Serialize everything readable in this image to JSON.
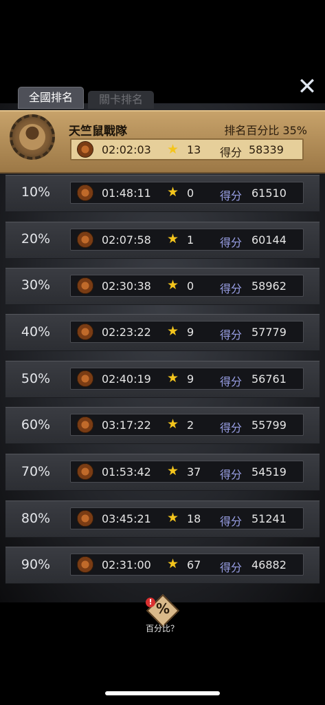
{
  "tabs": [
    {
      "label": "全國排名",
      "active": true
    },
    {
      "label": "關卡排名",
      "active": false
    }
  ],
  "close_icon": "close-icon",
  "me": {
    "name": "天竺鼠戰隊",
    "rank_label": "排名百分比 35%",
    "time": "02:02:03",
    "stars": "13",
    "score_label": "得分",
    "score": "58339"
  },
  "rows": [
    {
      "pct": "10%",
      "time": "01:48:11",
      "stars": "0",
      "score_label": "得分",
      "score": "61510"
    },
    {
      "pct": "20%",
      "time": "02:07:58",
      "stars": "1",
      "score_label": "得分",
      "score": "60144"
    },
    {
      "pct": "30%",
      "time": "02:30:38",
      "stars": "0",
      "score_label": "得分",
      "score": "58962"
    },
    {
      "pct": "40%",
      "time": "02:23:22",
      "stars": "9",
      "score_label": "得分",
      "score": "57779"
    },
    {
      "pct": "50%",
      "time": "02:40:19",
      "stars": "9",
      "score_label": "得分",
      "score": "56761"
    },
    {
      "pct": "60%",
      "time": "03:17:22",
      "stars": "2",
      "score_label": "得分",
      "score": "55799"
    },
    {
      "pct": "70%",
      "time": "01:53:42",
      "stars": "37",
      "score_label": "得分",
      "score": "54519"
    },
    {
      "pct": "80%",
      "time": "03:45:21",
      "stars": "18",
      "score_label": "得分",
      "score": "51241"
    },
    {
      "pct": "90%",
      "time": "02:31:00",
      "stars": "67",
      "score_label": "得分",
      "score": "46882"
    }
  ],
  "help": {
    "icon_text": "%",
    "alert": "!",
    "label": "百分比？"
  },
  "colors": {
    "accent_gold": "#c7a26a",
    "star": "#f4c51c",
    "score_label": "#9aa0e6"
  }
}
